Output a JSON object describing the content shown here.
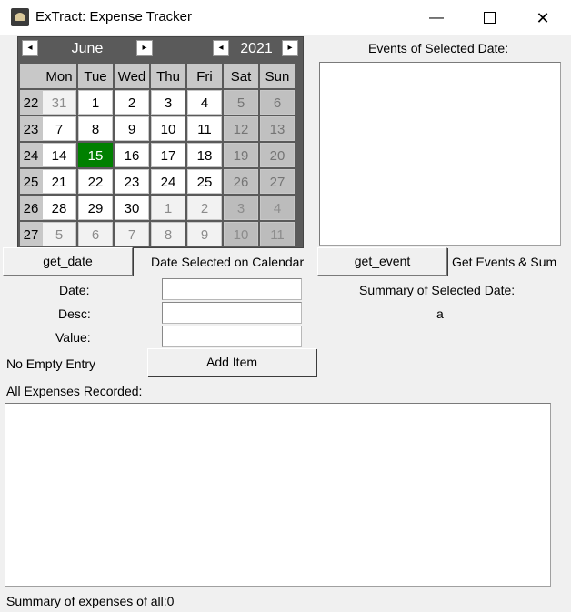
{
  "window": {
    "title": "ExTract: Expense Tracker",
    "minimize": "—",
    "close": "✕"
  },
  "calendar": {
    "month": "June",
    "year": "2021",
    "prev_arrow": "◂",
    "next_arrow": "▸",
    "weekday_headers": [
      "Mon",
      "Tue",
      "Wed",
      "Thu",
      "Fri",
      "Sat",
      "Sun"
    ],
    "weeks": [
      {
        "num": "22",
        "days": [
          {
            "d": "31",
            "t": "other"
          },
          {
            "d": "1",
            "t": "day"
          },
          {
            "d": "2",
            "t": "day"
          },
          {
            "d": "3",
            "t": "day"
          },
          {
            "d": "4",
            "t": "day"
          },
          {
            "d": "5",
            "t": "we"
          },
          {
            "d": "6",
            "t": "we"
          }
        ]
      },
      {
        "num": "23",
        "days": [
          {
            "d": "7",
            "t": "day"
          },
          {
            "d": "8",
            "t": "day"
          },
          {
            "d": "9",
            "t": "day"
          },
          {
            "d": "10",
            "t": "day"
          },
          {
            "d": "11",
            "t": "day"
          },
          {
            "d": "12",
            "t": "we"
          },
          {
            "d": "13",
            "t": "we"
          }
        ]
      },
      {
        "num": "24",
        "days": [
          {
            "d": "14",
            "t": "day"
          },
          {
            "d": "15",
            "t": "sel"
          },
          {
            "d": "16",
            "t": "day"
          },
          {
            "d": "17",
            "t": "day"
          },
          {
            "d": "18",
            "t": "day"
          },
          {
            "d": "19",
            "t": "we"
          },
          {
            "d": "20",
            "t": "we"
          }
        ]
      },
      {
        "num": "25",
        "days": [
          {
            "d": "21",
            "t": "day"
          },
          {
            "d": "22",
            "t": "day"
          },
          {
            "d": "23",
            "t": "day"
          },
          {
            "d": "24",
            "t": "day"
          },
          {
            "d": "25",
            "t": "day"
          },
          {
            "d": "26",
            "t": "we"
          },
          {
            "d": "27",
            "t": "we"
          }
        ]
      },
      {
        "num": "26",
        "days": [
          {
            "d": "28",
            "t": "day"
          },
          {
            "d": "29",
            "t": "day"
          },
          {
            "d": "30",
            "t": "day"
          },
          {
            "d": "1",
            "t": "other"
          },
          {
            "d": "2",
            "t": "other"
          },
          {
            "d": "3",
            "t": "otherwe"
          },
          {
            "d": "4",
            "t": "otherwe"
          }
        ]
      },
      {
        "num": "27",
        "days": [
          {
            "d": "5",
            "t": "other"
          },
          {
            "d": "6",
            "t": "other"
          },
          {
            "d": "7",
            "t": "other"
          },
          {
            "d": "8",
            "t": "other"
          },
          {
            "d": "9",
            "t": "other"
          },
          {
            "d": "10",
            "t": "otherwe"
          },
          {
            "d": "11",
            "t": "otherwe"
          }
        ]
      }
    ],
    "selected_color": "#008000"
  },
  "events_panel": {
    "label": "Events of Selected Date:"
  },
  "controls": {
    "get_date_button": "get_date",
    "date_selected_label": "Date Selected on Calendar",
    "get_event_button": "get_event",
    "get_events_sum_label": "Get Events & Sum",
    "summary_selected_label": "Summary of Selected Date:",
    "summary_selected_value": "a"
  },
  "form": {
    "date_label": "Date:",
    "desc_label": "Desc:",
    "value_label": "Value:",
    "date_value": "",
    "desc_value": "",
    "value_value": "",
    "status_text": "No Empty Entry",
    "add_button": "Add Item"
  },
  "expenses": {
    "label": "All Expenses Recorded:",
    "summary": "Summary of expenses of all:0"
  }
}
